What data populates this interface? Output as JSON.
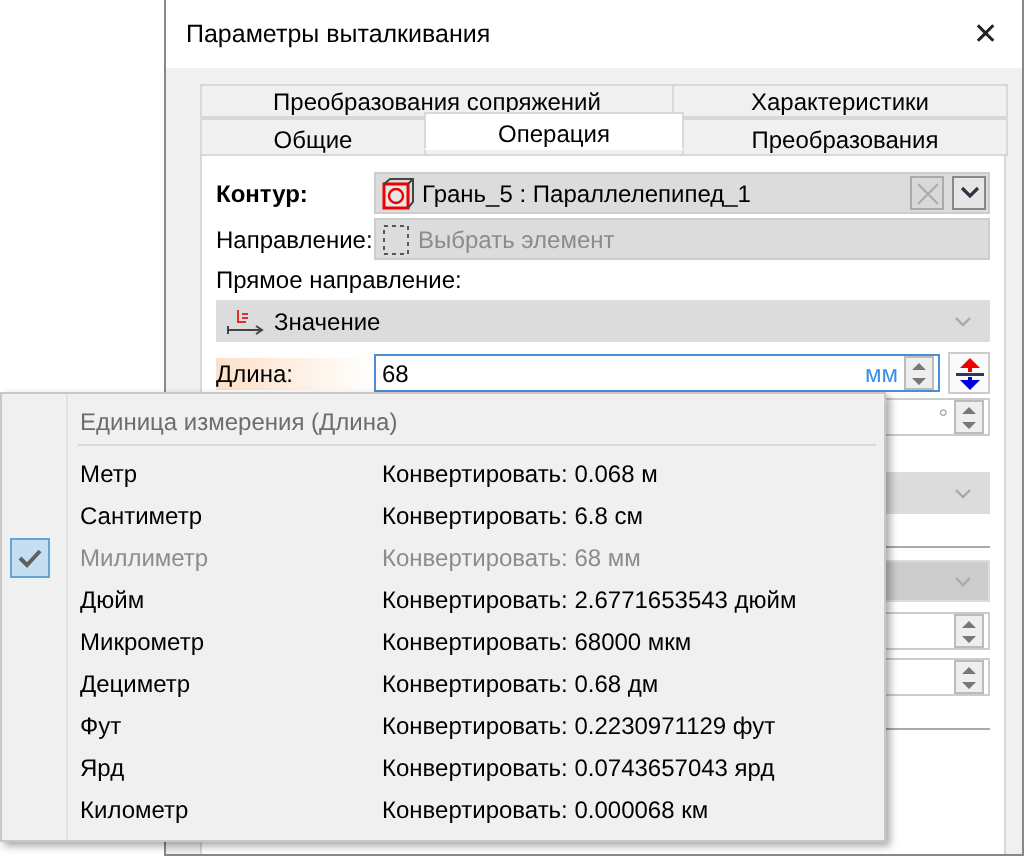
{
  "window": {
    "title": "Параметры выталкивания",
    "close": "✕"
  },
  "tab_rows": [
    [
      {
        "label": "Преобразования сопряжений",
        "selected": false
      },
      {
        "label": "Характеристики",
        "selected": false
      }
    ],
    [
      {
        "label": "Общие",
        "selected": false
      },
      {
        "label": "Операция",
        "selected": true
      },
      {
        "label": "Преобразования",
        "selected": false
      }
    ]
  ],
  "contour": {
    "label": "Контур:",
    "value": "Грань_5 : Параллелепипед_1"
  },
  "direction": {
    "label": "Направление:",
    "placeholder": "Выбрать элемент"
  },
  "forward": {
    "label": "Прямое направление:",
    "value": "Значение"
  },
  "length": {
    "label": "Длина:",
    "value": "68",
    "unit": "мм"
  },
  "angle": {
    "unit": "°"
  },
  "unit_menu": {
    "header": "Единица измерения (Длина)",
    "items": [
      {
        "name": "Метр",
        "convert": "Конвертировать: 0.068 м",
        "checked": false,
        "disabled": false
      },
      {
        "name": "Сантиметр",
        "convert": "Конвертировать: 6.8 см",
        "checked": false,
        "disabled": false
      },
      {
        "name": "Миллиметр",
        "convert": "Конвертировать: 68 мм",
        "checked": true,
        "disabled": true
      },
      {
        "name": "Дюйм",
        "convert": "Конвертировать: 2.6771653543 дюйм",
        "checked": false,
        "disabled": false
      },
      {
        "name": "Микрометр",
        "convert": "Конвертировать: 68000 мкм",
        "checked": false,
        "disabled": false
      },
      {
        "name": "Дециметр",
        "convert": "Конвертировать: 0.68 дм",
        "checked": false,
        "disabled": false
      },
      {
        "name": "Фут",
        "convert": "Конвертировать: 0.2230971129 фут",
        "checked": false,
        "disabled": false
      },
      {
        "name": "Ярд",
        "convert": "Конвертировать: 0.0743657043 ярд",
        "checked": false,
        "disabled": false
      },
      {
        "name": "Километр",
        "convert": "Конвертировать: 0.000068 км",
        "checked": false,
        "disabled": false
      }
    ]
  }
}
